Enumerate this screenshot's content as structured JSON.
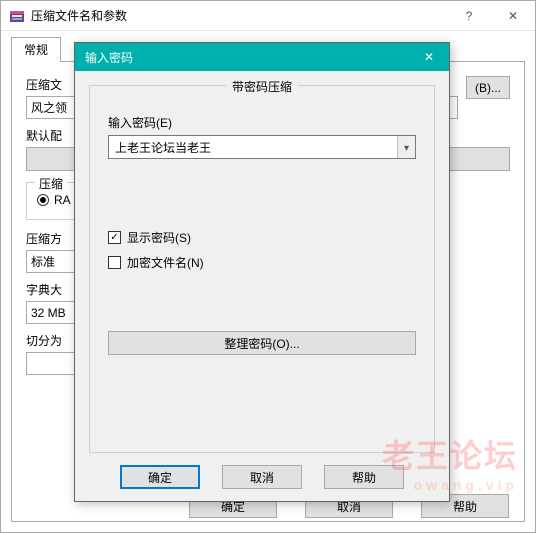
{
  "main": {
    "title": "压缩文件名和参数",
    "help_glyph": "?",
    "close_glyph": "✕",
    "tabs": {
      "general": "常规"
    },
    "archive_name_label": "压缩文",
    "archive_name_value": "风之领",
    "browse_label": "(B)...",
    "default_profile_label": "默认配",
    "format_group_label": "压缩",
    "format_rar_label": "RA",
    "method_label": "压缩方",
    "method_value": "标准",
    "dict_label": "字典大",
    "dict_value": "32 MB",
    "split_label": "切分为",
    "buttons": {
      "ok": "确定",
      "cancel": "取消",
      "help": "帮助"
    }
  },
  "pwd": {
    "title": "输入密码",
    "close_glyph": "✕",
    "group_legend": "带密码压缩",
    "enter_label": "输入密码(E)",
    "password_value": "上老王论坛当老王",
    "show_pwd_label": "显示密码(S)",
    "show_pwd_checked": true,
    "encrypt_names_label": "加密文件名(N)",
    "encrypt_names_checked": false,
    "organize_label": "整理密码(O)...",
    "buttons": {
      "ok": "确定",
      "cancel": "取消",
      "help": "帮助"
    }
  },
  "watermark": {
    "line1": "老王论坛",
    "line2": "owang.vip"
  }
}
